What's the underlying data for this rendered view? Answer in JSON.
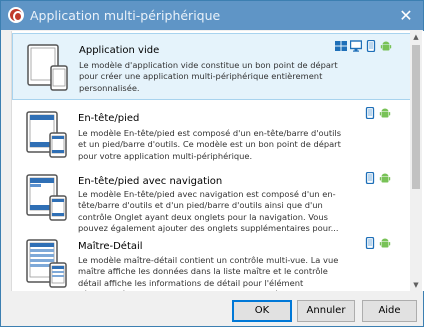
{
  "window": {
    "title": "Application multi-périphérique",
    "close_glyph": "✕"
  },
  "templates": [
    {
      "name": "Application vide",
      "description": "Le modèle d'application vide constitue un bon point de départ pour créer une application multi-périphérique entièrement personnalisée.",
      "platforms": [
        "windows-icon",
        "desktop-icon",
        "ios-phone-icon",
        "android-icon"
      ],
      "selected": true
    },
    {
      "name": "En-tête/pied",
      "description": "Le modèle En-tête/pied est composé d'un en-tête/barre d'outils et un pied/barre d'outils. Ce modèle est un bon point de départ pour votre application multi-périphérique.",
      "platforms": [
        "ios-phone-icon",
        "android-icon"
      ],
      "selected": false
    },
    {
      "name": "En-tête/pied avec navigation",
      "description": "Le modèle En-tête/pied avec navigation est composé d'un en-tête/barre d'outils et d'un pied/barre d'outils ainsi que d'un contrôle Onglet ayant deux onglets pour la navigation.  Vous pouvez également ajouter des onglets supplémentaires pour...",
      "platforms": [
        "ios-phone-icon",
        "android-icon"
      ],
      "selected": false
    },
    {
      "name": "Maître-Détail",
      "description": "Le modèle maître-détail contient un contrôle multi-vue. La vue maître affiche les données dans la liste maître et le contrôle détail affiche les informations de détail pour l'élément sélectionné.  Le composant Vue liste fournit différentes options de...",
      "platforms": [
        "ios-phone-icon",
        "android-icon"
      ],
      "selected": false
    }
  ],
  "buttons": {
    "ok": "OK",
    "cancel": "Annuler",
    "help": "Aide"
  },
  "colors": {
    "titlebar": "#5f95c6",
    "selection": "#e5f3fb",
    "accent": "#0078d7",
    "android": "#78c257",
    "windows": "#1e6fb8"
  }
}
